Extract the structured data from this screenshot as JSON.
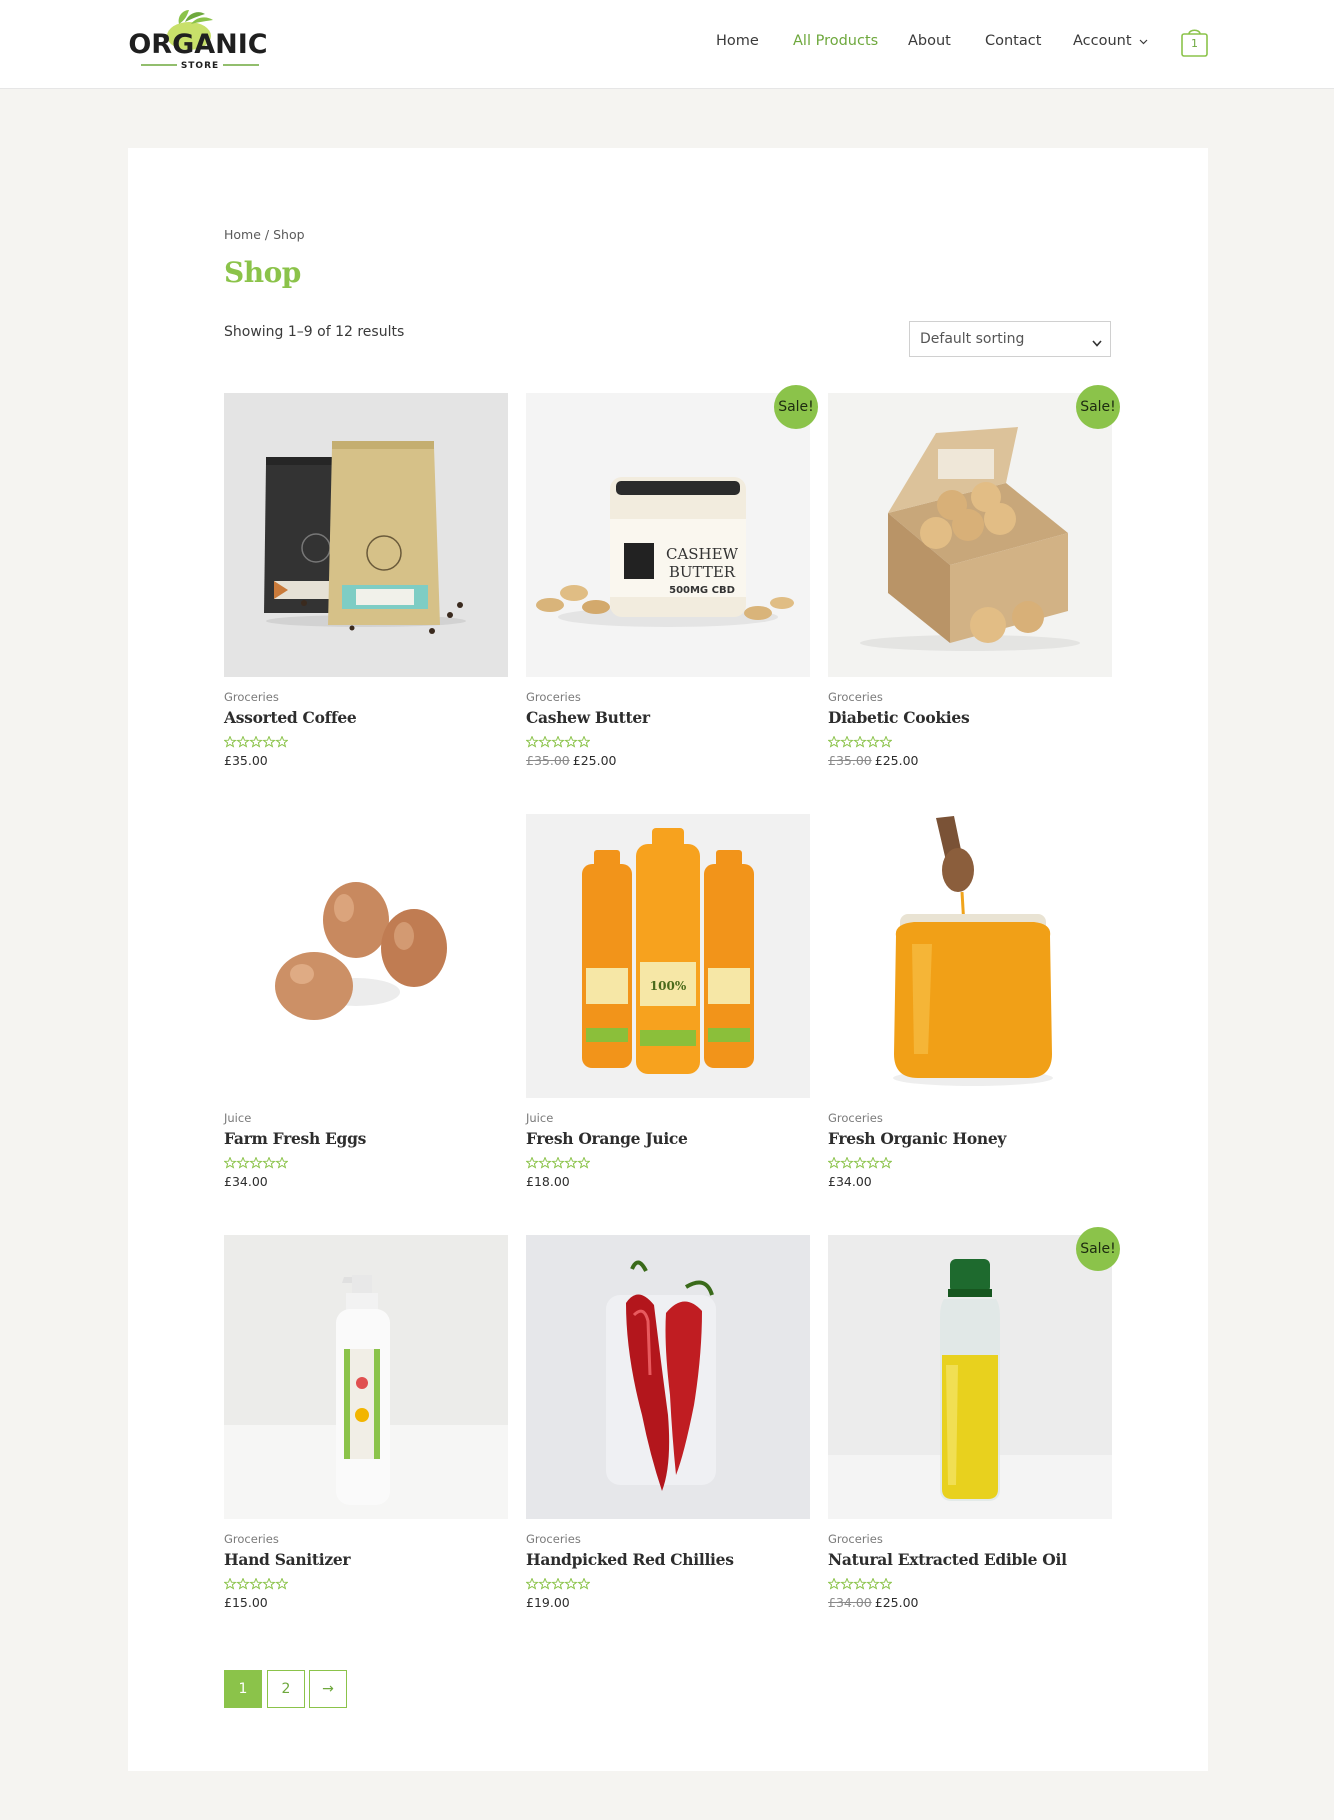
{
  "brand": {
    "name_top": "ORGANIC",
    "name_bottom": "STORE"
  },
  "nav": {
    "home": "Home",
    "all_products": "All Products",
    "about": "About",
    "contact": "Contact",
    "account": "Account",
    "cart_count": "1"
  },
  "breadcrumb": {
    "home": "Home",
    "separator": " / ",
    "current": "Shop"
  },
  "page_title": "Shop",
  "result_count": "Showing 1–9 of 12 results",
  "sorting": {
    "selected": "Default sorting"
  },
  "sale_label": "Sale!",
  "products": [
    {
      "category": "Groceries",
      "name": "Assorted Coffee",
      "old_price": "",
      "price": "£35.00",
      "on_sale": false,
      "rating": 0,
      "image": "coffee-bags"
    },
    {
      "category": "Groceries",
      "name": "Cashew Butter",
      "old_price": "£35.00",
      "price": "£25.00",
      "on_sale": true,
      "rating": 0,
      "image": "cashew-butter-jar"
    },
    {
      "category": "Groceries",
      "name": "Diabetic Cookies",
      "old_price": "£35.00",
      "price": "£25.00",
      "on_sale": true,
      "rating": 0,
      "image": "cookie-box"
    },
    {
      "category": "Juice",
      "name": "Farm Fresh Eggs",
      "old_price": "",
      "price": "£34.00",
      "on_sale": false,
      "rating": 0,
      "image": "eggs"
    },
    {
      "category": "Juice",
      "name": "Fresh Orange Juice",
      "old_price": "",
      "price": "£18.00",
      "on_sale": false,
      "rating": 0,
      "image": "juice-bottles"
    },
    {
      "category": "Groceries",
      "name": "Fresh Organic Honey",
      "old_price": "",
      "price": "£34.00",
      "on_sale": false,
      "rating": 0,
      "image": "honey-jar"
    },
    {
      "category": "Groceries",
      "name": "Hand Sanitizer",
      "old_price": "",
      "price": "£15.00",
      "on_sale": false,
      "rating": 0,
      "image": "sanitizer-bottle"
    },
    {
      "category": "Groceries",
      "name": "Handpicked Red Chillies",
      "old_price": "",
      "price": "£19.00",
      "on_sale": false,
      "rating": 0,
      "image": "red-chillies"
    },
    {
      "category": "Groceries",
      "name": "Natural Extracted Edible Oil",
      "old_price": "£34.00",
      "price": "£25.00",
      "on_sale": true,
      "rating": 0,
      "image": "oil-bottle"
    }
  ],
  "pagination": {
    "current": "1",
    "next_page": "2",
    "next_arrow": "→"
  },
  "colors": {
    "accent": "#8bc34a",
    "accent_text": "#6ea83d",
    "page_bg": "#f5f4f1"
  }
}
